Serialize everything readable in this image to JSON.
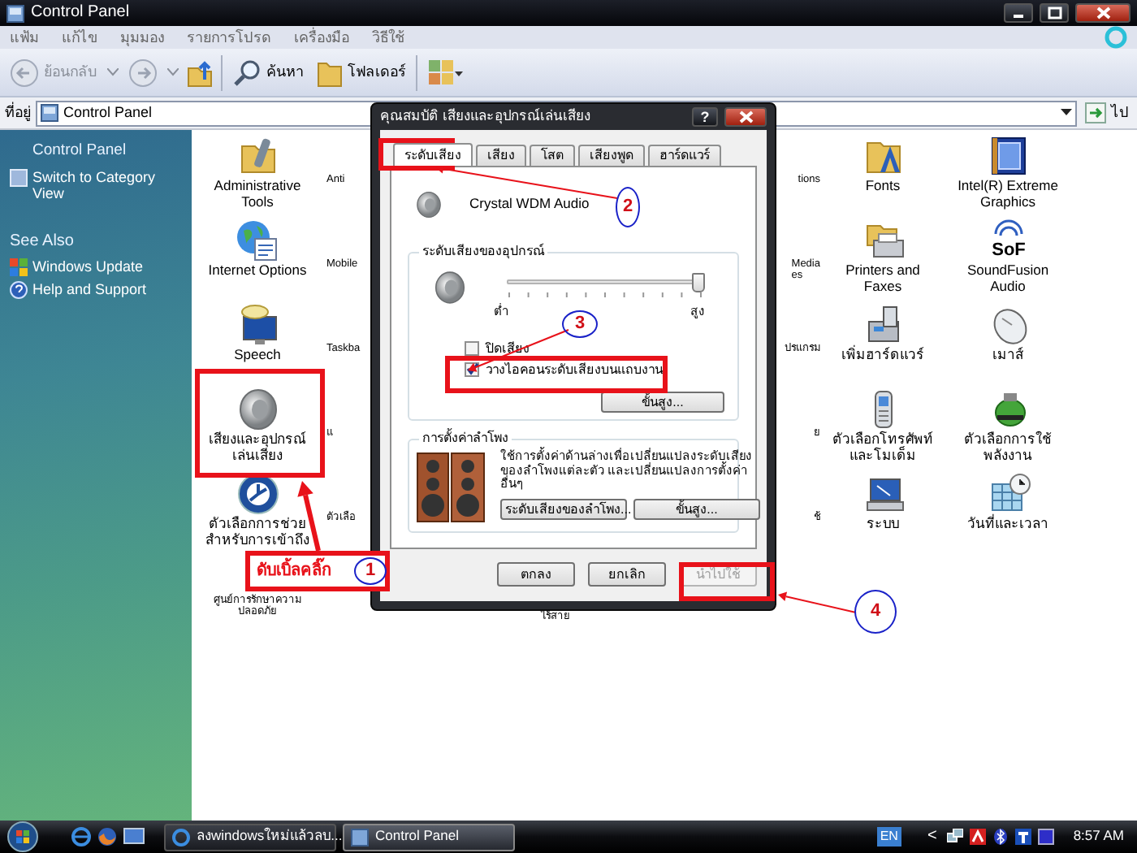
{
  "window": {
    "title": "Control Panel"
  },
  "menu": [
    {
      "label": "แฟ้ม"
    },
    {
      "label": "แก้ไข"
    },
    {
      "label": "มุมมอง"
    },
    {
      "label": "รายการโปรด"
    },
    {
      "label": "เครื่องมือ"
    },
    {
      "label": "วิธีใช้"
    }
  ],
  "toolbar": {
    "back": {
      "label": "ย้อนกลับ",
      "disabled": true
    },
    "search": {
      "label": "ค้นหา"
    },
    "folders": {
      "label": "โฟลเดอร์"
    }
  },
  "address": {
    "label": "ที่อยู่",
    "value": "Control Panel",
    "go": "ไป"
  },
  "sidebar": {
    "title": "Control Panel",
    "items": [
      {
        "label": "Switch to Category View"
      }
    ],
    "see_also": {
      "title": "See Also",
      "items": [
        {
          "label": "Windows Update",
          "kind": "update"
        },
        {
          "label": "Help and Support",
          "kind": "help"
        }
      ]
    }
  },
  "icons": [
    {
      "label": "Administrative Tools",
      "kind": "tools"
    },
    {
      "label": "Anti",
      "kind": "partial"
    },
    {
      "label": "tions",
      "kind": "partial"
    },
    {
      "label": "Fonts",
      "kind": "fonts"
    },
    {
      "label": "Intel(R) Extreme Graphics",
      "kind": "graphics"
    },
    {
      "label": "Internet Options",
      "kind": "internet"
    },
    {
      "label": "Mobile",
      "kind": "partial"
    },
    {
      "label": "Media es",
      "kind": "partial"
    },
    {
      "label": "Printers and Faxes",
      "kind": "printers"
    },
    {
      "label": "SoundFusion Audio",
      "kind": "soundfusion",
      "logo": "SoF"
    },
    {
      "label": "Speech",
      "kind": "speech"
    },
    {
      "label": "Taskba",
      "kind": "partial"
    },
    {
      "label": "ปรแกรม",
      "kind": "partial"
    },
    {
      "label": "เพิ่มฮาร์ดแวร์",
      "kind": "hardware"
    },
    {
      "label": "เมาส์",
      "kind": "mouse"
    },
    {
      "label": "เสียงและอุปกรณ์เล่นเสียง",
      "kind": "sound"
    },
    {
      "label": "แ",
      "kind": "partial"
    },
    {
      "label": "ย",
      "kind": "partial"
    },
    {
      "label": "ตัวเลือกโทรศัพท์และโมเด็ม",
      "kind": "phone"
    },
    {
      "label": "ตัวเลือกการใช้พลังงาน",
      "kind": "power"
    },
    {
      "label": "ตัวเลือกการช่วยสำหรับการเข้าถึง",
      "kind": "accessibility"
    },
    {
      "label": "ตัวเลือ",
      "kind": "partial"
    },
    {
      "label": "ช้",
      "kind": "partial"
    },
    {
      "label": "ระบบ",
      "kind": "system"
    },
    {
      "label": "วันที่และเวลา",
      "kind": "datetime"
    },
    {
      "label": "ศูนย์การรักษาความปลอดภัย",
      "kind": "covered"
    },
    {
      "label": "ไร้สาย",
      "kind": "partial"
    }
  ],
  "dialog": {
    "title": "คุณสมบัติ เสียงและอุปกรณ์เล่นเสียง",
    "help": "?",
    "tabs": [
      {
        "label": "ระดับเสียง",
        "selected": true
      },
      {
        "label": "เสียง",
        "selected": false
      },
      {
        "label": "โสต",
        "selected": false
      },
      {
        "label": "เสียงพูด",
        "selected": false
      },
      {
        "label": "ฮาร์ดแวร์",
        "selected": false
      }
    ],
    "device": "Crystal WDM Audio",
    "volume": {
      "title": "ระดับเสียงของอุปกรณ์",
      "level": 1,
      "low": "ต่ำ",
      "high": "สูง",
      "options": [
        {
          "label": "ปิดเสียง",
          "checked": false
        },
        {
          "label": "วางไอคอนระดับเสียงบนแถบงาน",
          "checked": true
        }
      ],
      "advanced": "ขั้นสูง..."
    },
    "speakers": {
      "title": "การตั้งค่าลำโพง",
      "text": "ใช้การตั้งค่าด้านล่างเพื่อเปลี่ยนแปลงระดับเสียงของลำโพงแต่ละตัว และเปลี่ยนแปลงการตั้งค่าอื่นๆ",
      "buttons": [
        {
          "label": "ระดับเสียงของลำโพง..."
        },
        {
          "label": "ขั้นสูง..."
        }
      ]
    },
    "buttons": [
      {
        "label": "ตกลง",
        "disabled": false
      },
      {
        "label": "ยกเลิก",
        "disabled": false
      },
      {
        "label": "นำไปใช้",
        "disabled": true
      }
    ]
  },
  "taskbar": {
    "tasks": [
      {
        "label": "ลงwindowsใหม่แล้วลบ...",
        "selected": false
      },
      {
        "label": "Control Panel",
        "selected": true
      }
    ],
    "language": "EN",
    "tray_toggle": "<",
    "clock": "8:57 AM"
  },
  "annotations": {
    "label": "ดับเบิ้ลคลิ๊ก",
    "steps": [
      {
        "number": "1"
      },
      {
        "number": "2"
      },
      {
        "number": "3"
      },
      {
        "number": "4"
      }
    ]
  }
}
